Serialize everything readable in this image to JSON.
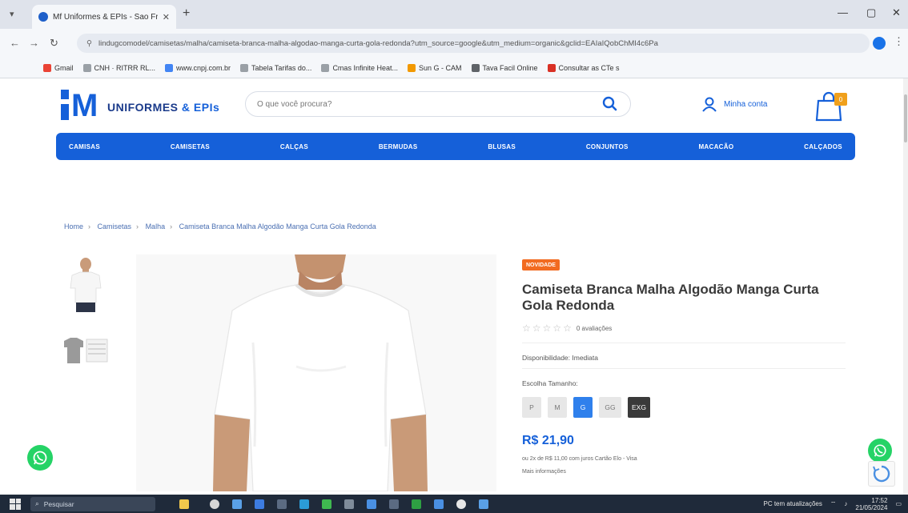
{
  "browser": {
    "tab_title": "Mf Uniformes & EPIs - Sao Fr...",
    "url": "lindugcomodel/camisetas/malha/camiseta-branca-malha-algodao-manga-curta-gola-redonda?utm_source=google&utm_medium=organic&gclid=EAIaIQobChMI4c6Pa",
    "bookmarks": [
      "Gmail",
      "CNH · RITRR RL...",
      "www.cnpj.com.br",
      "Tabela Tarifas do...",
      "Cmas Infinite Heat...",
      "Sun G - CAM",
      "Tava Facil Online",
      "Consultar as CTe s"
    ]
  },
  "site": {
    "logo_text": "UNIFORMES",
    "logo_amp": "& EPIs",
    "search_placeholder": "O que você procura?",
    "account_label": "Minha conta",
    "cart_count": "0",
    "categories": [
      "CAMISAS",
      "CAMISETAS",
      "CALÇAS",
      "BERMUDAS",
      "BLUSAS",
      "CONJUNTOS",
      "MACACÃO",
      "CALÇADOS"
    ]
  },
  "breadcrumb": {
    "home": "Home",
    "l1": "Camisetas",
    "l2": "Malha",
    "current": "Camiseta Branca Malha Algodão Manga Curta Gola Redonda"
  },
  "product": {
    "badge": "NOVIDADE",
    "title": "Camiseta Branca Malha Algodão Manga Curta Gola Redonda",
    "rating_stars": 0,
    "reviews": "0 avaliações",
    "availability": "Disponibilidade: Imediata",
    "size_label": "Escolha Tamanho:",
    "sizes": [
      "P",
      "M",
      "G",
      "GG",
      "EXG"
    ],
    "selected_size": "G",
    "price": "R$ 21,90",
    "installments": "ou 2x de R$ 11,00 com juros Cartão Elo - Visa",
    "more_info": "Mais informações"
  },
  "taskbar": {
    "search_placeholder": "Pesquisar",
    "tray_text": "PC tem atualizações",
    "time": "17:52",
    "date": "21/05/2024"
  },
  "colors": {
    "brand_blue": "#1560d9",
    "badge_orange": "#f26b21",
    "cart_badge": "#f0a01c",
    "whatsapp": "#25d366"
  }
}
